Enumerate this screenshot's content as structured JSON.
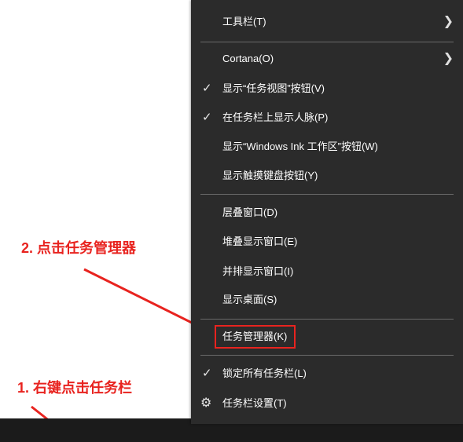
{
  "context_menu": {
    "items": {
      "toolbars": "工具栏(T)",
      "cortana": "Cortana(O)",
      "show_task_view": "显示“任务视图”按钮(V)",
      "show_people": "在任务栏上显示人脉(P)",
      "show_ink": "显示“Windows Ink 工作区”按钮(W)",
      "show_touch_keyboard": "显示触摸键盘按钮(Y)",
      "cascade": "层叠窗口(D)",
      "stack": "堆叠显示窗口(E)",
      "side_by_side": "并排显示窗口(I)",
      "show_desktop": "显示桌面(S)",
      "task_manager": "任务管理器(K)",
      "lock_taskbars": "锁定所有任务栏(L)",
      "taskbar_settings": "任务栏设置(T)"
    },
    "checked": [
      "show_task_view",
      "show_people",
      "lock_taskbars"
    ]
  },
  "annotations": {
    "step1": "1. 右键点击任务栏",
    "step2": "2. 点击任务管理器"
  },
  "colors": {
    "annotation": "#e8231f",
    "menu_background": "#2b2b2b",
    "taskbar": "#1b1b1b"
  },
  "icons": {
    "submenu": "chevron-right-icon",
    "checked": "checkmark-icon",
    "settings": "gear-icon"
  }
}
